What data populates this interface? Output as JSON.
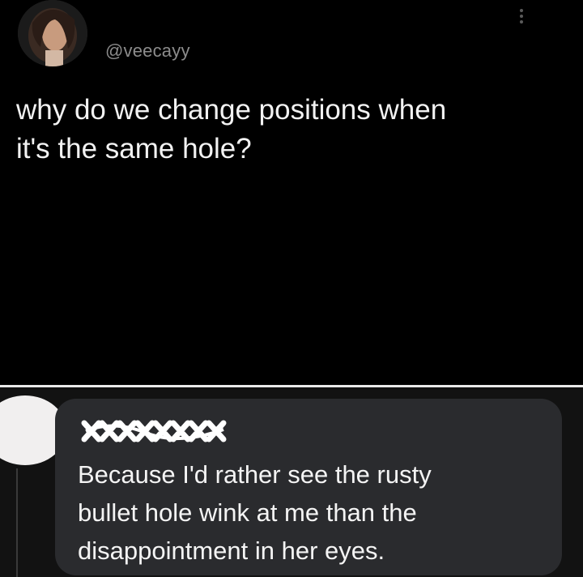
{
  "tweet": {
    "handle": "@veecayy",
    "text": "why do we change positions when\nit's the same hole?",
    "avatar_icon": "profile-photo-avatar",
    "menu_icon": "vertical-ellipsis-icon"
  },
  "reply": {
    "author_redacted": true,
    "text": "Because I'd rather see the rusty\nbullet hole wink at me than the\ndisappointment in her eyes.",
    "avatar_icon": "redacted-avatar"
  },
  "colors": {
    "tweet_background": "#000000",
    "reply_background": "#121212",
    "bubble_background": "#2a2b2e",
    "divider": "#e9e9e9",
    "handle_text": "#8c8c8c"
  }
}
